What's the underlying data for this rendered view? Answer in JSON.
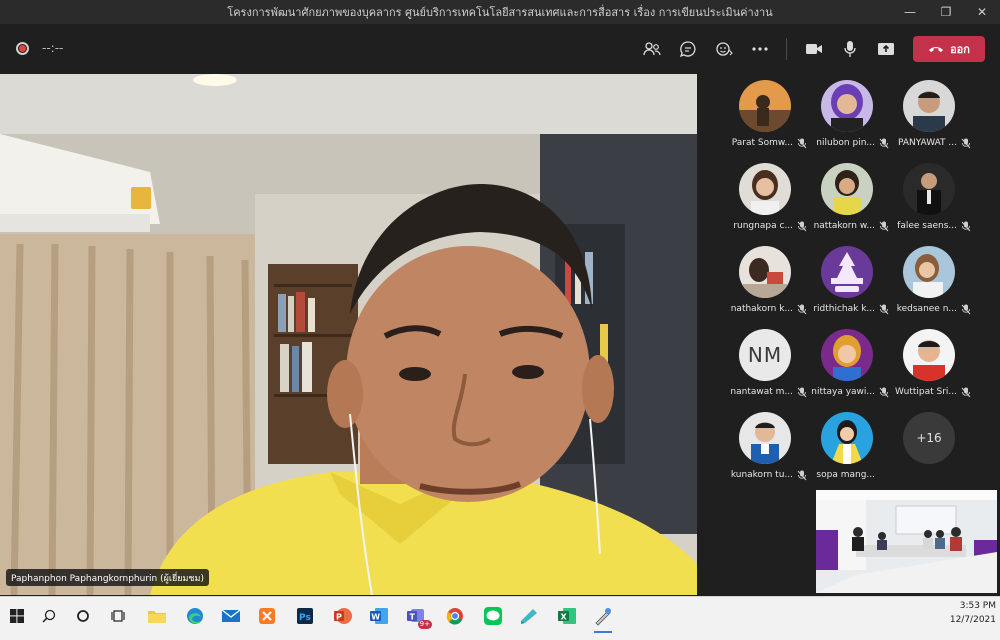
{
  "window": {
    "title": "โครงการพัฒนาศักยภาพของบุคลากร ศูนย์บริการเทคโนโลยีสารสนเทศและการสื่อสาร เรื่อง การเขียนประเมินค่างาน",
    "minimize": "—",
    "maximize": "❐",
    "close": "✕"
  },
  "meeting_toolbar": {
    "timer": "--:--",
    "leave_label": "ออก",
    "leave_color": "#c4314b",
    "icons": [
      "participants-icon",
      "chat-icon",
      "reactions-icon",
      "more-icon",
      "camera-icon",
      "mic-icon",
      "share-icon"
    ]
  },
  "main_speaker": {
    "name": "Paphanphon Paphangkornphurin (ผู้เยี่ยมชม)"
  },
  "participants": [
    {
      "name": "Parat Somw..."
    },
    {
      "name": "nilubon pin..."
    },
    {
      "name": "PANYAWAT ..."
    },
    {
      "name": "rungnapa c..."
    },
    {
      "name": "nattakorn w..."
    },
    {
      "name": "falee saens..."
    },
    {
      "name": "nathakorn k..."
    },
    {
      "name": "ridthichak k..."
    },
    {
      "name": "kedsanee n..."
    },
    {
      "name": "nantawat m...",
      "initials": "NM"
    },
    {
      "name": "nittaya yawi..."
    },
    {
      "name": "Wuttipat Sri..."
    },
    {
      "name": "kunakorn tu..."
    },
    {
      "name": "sopa mang..."
    }
  ],
  "overflow_count": "+16",
  "taskbar": {
    "apps": [
      "windows-start-icon",
      "search-icon",
      "cortana-icon",
      "task-view-icon",
      "file-explorer-icon",
      "edge-icon",
      "mail-icon",
      "xampp-icon",
      "photoshop-icon",
      "powerpoint-icon",
      "word-icon",
      "teams-icon",
      "chrome-icon",
      "line-icon",
      "sticky-notes-icon",
      "excel-icon",
      "paint-icon"
    ],
    "teams_badge": "9+",
    "time": "3:53 PM",
    "date": "12/7/2021"
  }
}
